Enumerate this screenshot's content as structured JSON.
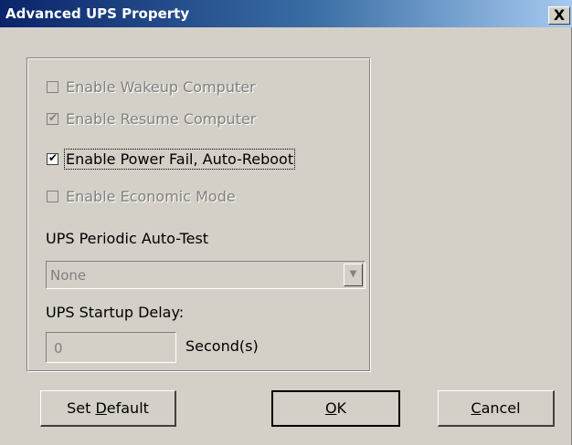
{
  "window": {
    "title": "Advanced UPS Property",
    "close_glyph": "X"
  },
  "options": [
    {
      "label": "Enable Wakeup Computer",
      "checked": false,
      "enabled": false
    },
    {
      "label": "Enable Resume Computer",
      "checked": true,
      "enabled": false
    },
    {
      "label": "Enable Power Fail, Auto-Reboot",
      "checked": true,
      "enabled": true
    },
    {
      "label": "Enable Economic Mode",
      "checked": false,
      "enabled": false
    }
  ],
  "auto_test": {
    "label": "UPS Periodic Auto-Test",
    "value": "None"
  },
  "startup_delay": {
    "label": "UPS Startup Delay:",
    "value": "0",
    "unit": "Second(s)"
  },
  "buttons": {
    "set_default": {
      "pre": "Set ",
      "mnemonic": "D",
      "post": "efault"
    },
    "ok": {
      "pre": "",
      "mnemonic": "O",
      "post": "K"
    },
    "cancel": {
      "pre": "",
      "mnemonic": "C",
      "post": "ancel"
    }
  },
  "colors": {
    "face": "#d4d0c8",
    "title_active": "#0a246a",
    "disabled_text": "#808080"
  }
}
